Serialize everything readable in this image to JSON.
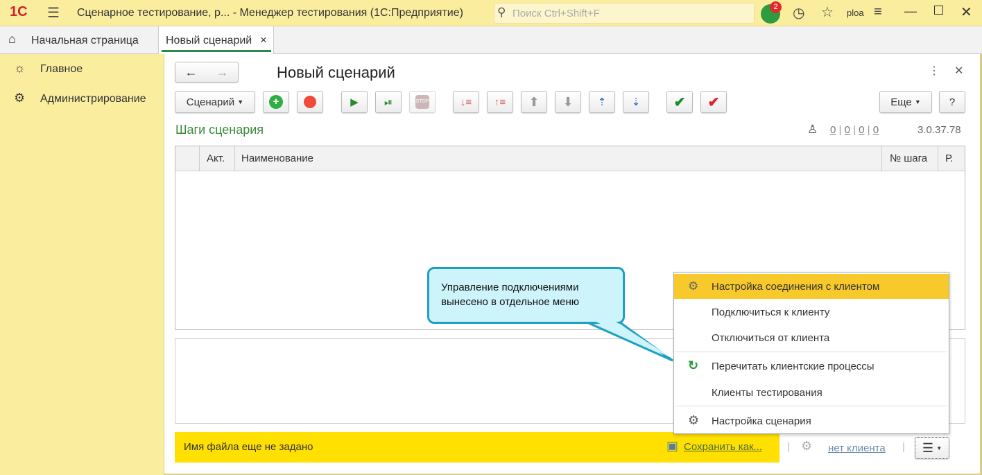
{
  "app": {
    "logo": "1С",
    "title": "Сценарное тестирование, р...   - Менеджер тестирования (1С:Предприятие)",
    "search_placeholder": "Поиск Ctrl+Shift+F",
    "notifications_count": "2",
    "user": "ploa"
  },
  "tabs": [
    {
      "label": "Начальная страница"
    },
    {
      "label": "Новый сценарий",
      "close": "×"
    }
  ],
  "sidebar": {
    "items": [
      {
        "label": "Главное",
        "icon": "bug-icon"
      },
      {
        "label": "Администрирование",
        "icon": "gear-icon"
      }
    ]
  },
  "form": {
    "title": "Новый сценарий",
    "scenario_button": "Сценарий",
    "more_button": "Еще",
    "help_button": "?",
    "section_title": "Шаги сценария",
    "counters": [
      "0",
      "0",
      "0",
      "0"
    ],
    "version": "3.0.37.78"
  },
  "table": {
    "columns": [
      "Акт.",
      "Наименование",
      "№ шага",
      "Р."
    ]
  },
  "callout": {
    "text": "Управление подключениями вынесено в отдельное меню"
  },
  "menu": {
    "items": [
      {
        "label": "Настройка соединения с клиентом",
        "icon": "connection-settings-icon",
        "highlighted": true
      },
      {
        "label": "Подключиться к клиенту"
      },
      {
        "label": "Отключиться от клиента"
      },
      {
        "label": "Перечитать клиентские процессы",
        "icon": "refresh-icon"
      },
      {
        "label": "Клиенты тестирования"
      },
      {
        "label": "Настройка сценария",
        "icon": "gear-icon"
      }
    ]
  },
  "statusbar": {
    "file_status": "Имя файла еще не задано",
    "save_as": "Сохранить как...",
    "client": "нет клиента"
  },
  "colors": {
    "accent_yellow": "#fbed9e",
    "status_yellow": "#ffe000",
    "section_green": "#3a8a3a",
    "menu_highlight": "#f7c92a",
    "callout_border": "#1ea0c0"
  }
}
